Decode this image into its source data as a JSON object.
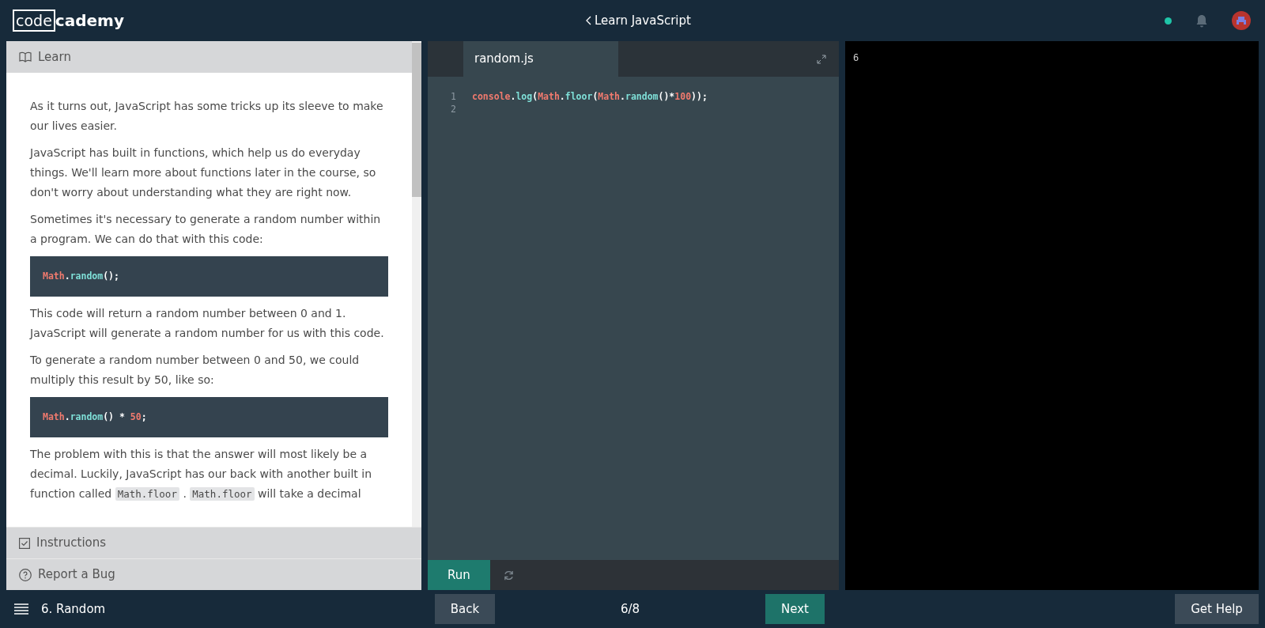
{
  "header": {
    "logo_boxed": "code",
    "logo_rest": "cademy",
    "back_link": "Learn JavaScript"
  },
  "learn_header": {
    "label": "Learn"
  },
  "lesson": [
    {
      "kind": "para",
      "segments": [
        {
          "kind": "text",
          "text": "As it turns out, JavaScript has some tricks up its sleeve to make our lives easier."
        }
      ]
    },
    {
      "kind": "para",
      "segments": [
        {
          "kind": "text",
          "text": "JavaScript has built in functions, which help us do everyday things. We'll learn more about functions later in the course, so don't worry about understanding what they are right now."
        }
      ]
    },
    {
      "kind": "para",
      "segments": [
        {
          "kind": "text",
          "text": "Sometimes it's necessary to generate a random number within a program. We can do that with this code:"
        }
      ]
    },
    {
      "kind": "code",
      "tokens": [
        {
          "kind": "obj",
          "text": "Math"
        },
        {
          "kind": "punct",
          "text": "."
        },
        {
          "kind": "fn",
          "text": "random"
        },
        {
          "kind": "punct",
          "text": "();"
        }
      ]
    },
    {
      "kind": "para",
      "segments": [
        {
          "kind": "text",
          "text": "This code will return a random number between 0 and 1. JavaScript will generate a random number for us with this code."
        }
      ]
    },
    {
      "kind": "para",
      "segments": [
        {
          "kind": "text",
          "text": "To generate a random number between 0 and 50, we could multiply this result by 50, like so:"
        }
      ]
    },
    {
      "kind": "code",
      "tokens": [
        {
          "kind": "obj",
          "text": "Math"
        },
        {
          "kind": "punct",
          "text": "."
        },
        {
          "kind": "fn",
          "text": "random"
        },
        {
          "kind": "punct",
          "text": "() * "
        },
        {
          "kind": "num",
          "text": "50"
        },
        {
          "kind": "punct",
          "text": ";"
        }
      ]
    },
    {
      "kind": "para",
      "segments": [
        {
          "kind": "text",
          "text": "The problem with this is that the answer will most likely be a decimal. Luckily, JavaScript has our back with another built in function called"
        },
        {
          "kind": "code",
          "text": "Math.floor"
        },
        {
          "kind": "text",
          "text": "."
        },
        {
          "kind": "code",
          "text": "Math.floor"
        },
        {
          "kind": "text",
          "text": "will take a decimal"
        }
      ]
    }
  ],
  "footer_items": [
    {
      "kind": "instructions",
      "label": "Instructions"
    },
    {
      "kind": "help",
      "label": "Report a Bug"
    }
  ],
  "editor": {
    "tab": "random.js",
    "lines": [
      {
        "number": "1",
        "tokens": [
          {
            "kind": "obj",
            "text": "console"
          },
          {
            "kind": "punct",
            "text": "."
          },
          {
            "kind": "fn",
            "text": "log"
          },
          {
            "kind": "punct",
            "text": "("
          },
          {
            "kind": "obj",
            "text": "Math"
          },
          {
            "kind": "punct",
            "text": "."
          },
          {
            "kind": "fn",
            "text": "floor"
          },
          {
            "kind": "punct",
            "text": "("
          },
          {
            "kind": "obj",
            "text": "Math"
          },
          {
            "kind": "punct",
            "text": "."
          },
          {
            "kind": "fn",
            "text": "random"
          },
          {
            "kind": "punct",
            "text": "()*"
          },
          {
            "kind": "num",
            "text": "100"
          },
          {
            "kind": "punct",
            "text": "));"
          }
        ]
      },
      {
        "number": "2"
      }
    ],
    "run_button": "Run"
  },
  "output": {
    "lines": [
      "6"
    ]
  },
  "bottom_bar": {
    "lesson_title": "6. Random",
    "back": "Back",
    "progress": "6/8",
    "next": "Next",
    "help": "Get Help"
  }
}
